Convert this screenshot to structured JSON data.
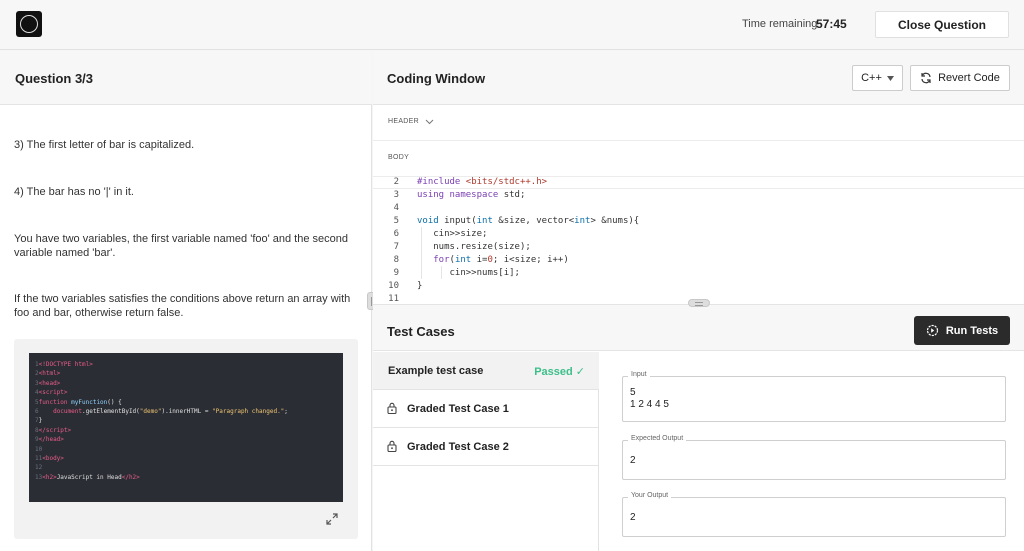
{
  "topbar": {
    "time_label": "Time remaining",
    "time_value": "57:45",
    "close_label": "Close Question"
  },
  "question": {
    "title": "Question 3/3",
    "paragraphs": [
      "3) The first letter of bar is capitalized.",
      "4) The bar has no '|' in it.",
      "You have two variables, the first variable named 'foo' and the second variable named 'bar'.",
      "If the two variables satisfies the conditions above return an array with foo and bar, otherwise return false."
    ]
  },
  "coding": {
    "title": "Coding Window",
    "language": "C++",
    "revert_label": "Revert Code",
    "header_label": "HEADER",
    "body_label": "BODY",
    "line_numbers": [
      "2",
      "3",
      "4",
      "5",
      "6",
      "7",
      "8",
      "9",
      "10",
      "11"
    ]
  },
  "tests": {
    "title": "Test Cases",
    "run_label": "Run Tests",
    "cases": [
      {
        "name": "Example test case",
        "status": "Passed ✓"
      },
      {
        "name": "Graded Test Case 1"
      },
      {
        "name": "Graded Test Case 2"
      }
    ],
    "input_label": "Input",
    "input_value": "5\n1 2 4 4 5",
    "expected_label": "Expected Output",
    "expected_value": "2",
    "your_label": "Your Output",
    "your_value": "2"
  },
  "icons": {
    "logo": "logo-icon",
    "chevron": "chevron-down-icon",
    "revert": "refresh-icon",
    "run": "gear-play-icon",
    "lock": "lock-icon",
    "expand": "expand-icon"
  }
}
